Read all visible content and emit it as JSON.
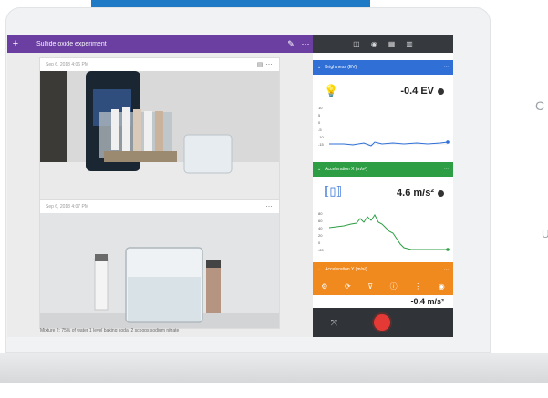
{
  "notebook": {
    "title": "Sulfide oxide experiment",
    "cards": [
      {
        "caption": "Sep 6, 2018 4:06 PM"
      },
      {
        "caption": "Sep 6, 2018 4:07 PM"
      }
    ],
    "note_text": "Mixture 2: 75% of water 1 level baking soda, 2 scoops sodium nitrate"
  },
  "panel": {
    "sensors": [
      {
        "name": "Brightness (EV)",
        "reading": "-0.4 EV",
        "color": "#2f6fd6",
        "icon": "lightbulb-icon",
        "axis": [
          "10",
          "5",
          "0",
          "-5",
          "-10",
          "-15"
        ]
      },
      {
        "name": "Acceleration X (m/s²)",
        "reading": "4.6 m/s²",
        "color": "#2e9e44",
        "icon": "phone-accel-icon",
        "axis": [
          "80",
          "60",
          "40",
          "20",
          "0",
          "-20"
        ]
      },
      {
        "name": "Acceleration Y (m/s²)",
        "reading": "-0.4 m/s²",
        "color": "#f08a1f",
        "icon": "phone-accel-icon",
        "axis": []
      }
    ]
  },
  "edge_text": {
    "c": "C",
    "u": "U"
  }
}
